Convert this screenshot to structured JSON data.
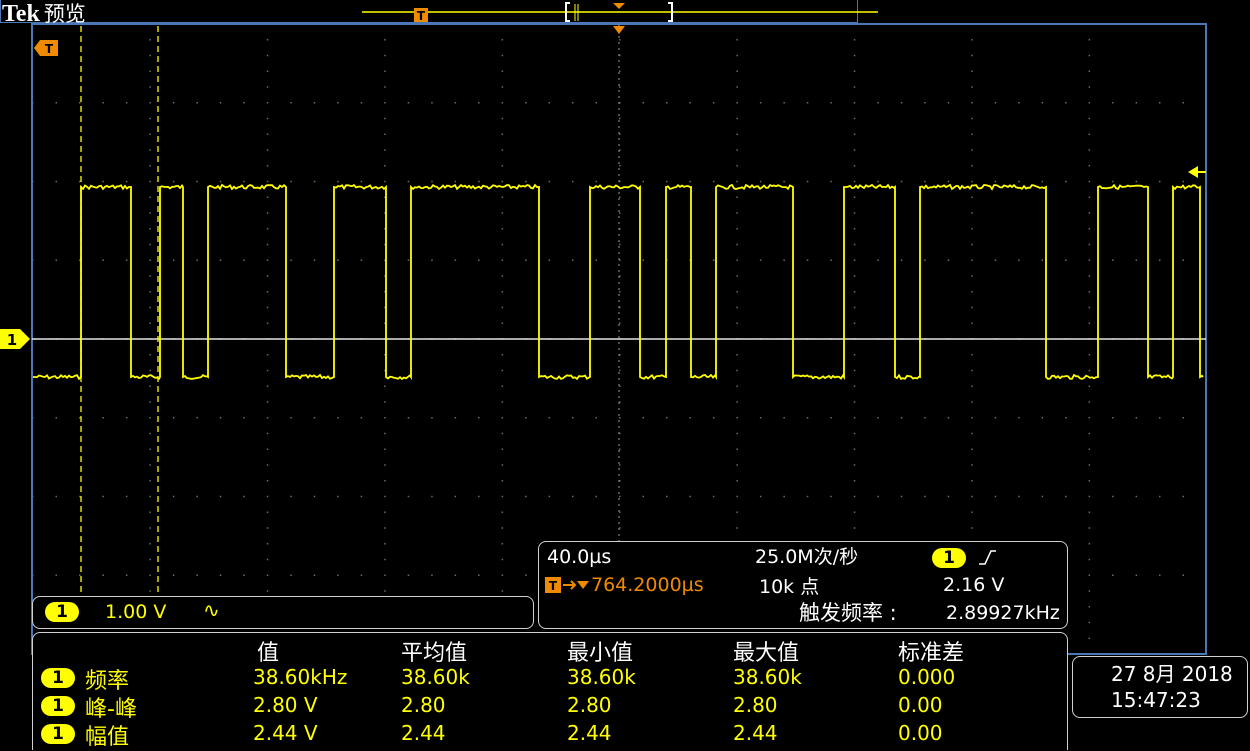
{
  "header": {
    "brand": "Tek",
    "mode": "预览"
  },
  "channel": {
    "number": "1",
    "scale": "1.00 V",
    "coupling_icon": "∿"
  },
  "horizontal": {
    "time_per_div": "40.0µs",
    "sample_rate": "25.0M次/秒",
    "trigger_position": "764.2000µs",
    "record_length": "10k 点",
    "trigger_channel": "1",
    "trigger_slope_icon": "rising-edge-icon",
    "trigger_level": "2.16 V",
    "trigger_freq_label": "触发频率 :",
    "trigger_freq_value": "2.89927kHz"
  },
  "measurements": {
    "headers": [
      "值",
      "平均值",
      "最小值",
      "最大值",
      "标准差"
    ],
    "rows": [
      {
        "channel": "1",
        "name": "频率",
        "values": [
          "38.60kHz",
          "38.60k",
          "38.60k",
          "38.60k",
          "0.000"
        ]
      },
      {
        "channel": "1",
        "name": "峰-峰",
        "values": [
          "2.80 V",
          "2.80",
          "2.80",
          "2.80",
          "0.00"
        ]
      },
      {
        "channel": "1",
        "name": "幅值",
        "values": [
          "2.44 V",
          "2.44",
          "2.44",
          "2.44",
          "0.00"
        ]
      }
    ]
  },
  "datetime": {
    "date": "27 8月 2018",
    "time": "15:47:23"
  },
  "markers": {
    "trigger_marker": "T",
    "channel_marker": "1"
  },
  "colors": {
    "trace": "#ffff00",
    "trigger": "#f08a00",
    "grid": "#5a5a5a",
    "frame": "#4a78b4"
  }
}
